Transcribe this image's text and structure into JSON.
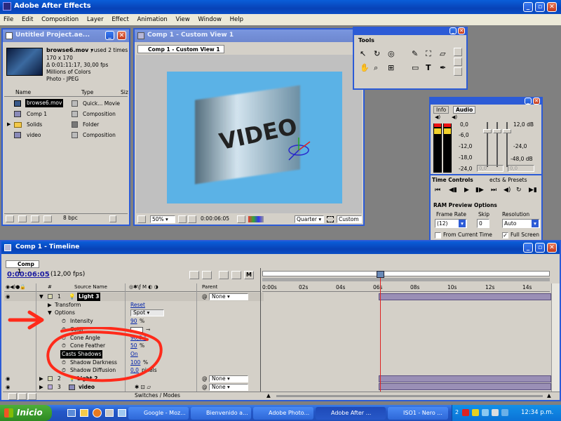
{
  "app": {
    "title": "Adobe After Effects",
    "menu": [
      "File",
      "Edit",
      "Composition",
      "Layer",
      "Effect",
      "Animation",
      "View",
      "Window",
      "Help"
    ]
  },
  "project": {
    "title": "Untitled Project.ae...",
    "file_name": "browse6.mov ▾",
    "used": ", used 2 times",
    "dims": "170 x 170",
    "duration": "Δ 0:01:11:17, 30,00 fps",
    "colors": "Millions of Colors",
    "codec": "Photo - JPEG",
    "col_name": "Name",
    "col_type": "Type",
    "col_size": "Siz",
    "items": [
      {
        "name": "browse6.mov",
        "type": "Quick... Movie"
      },
      {
        "name": "Comp 1",
        "type": "Composition"
      },
      {
        "name": "Solids",
        "type": "Folder"
      },
      {
        "name": "video",
        "type": "Composition"
      }
    ],
    "bpc": "8 bpc"
  },
  "comp": {
    "title": "Comp 1 - Custom View 1",
    "tab": "Comp 1 - Custom View 1",
    "zoom": "50%",
    "time": "0:00:06:05",
    "resolution": "Quarter",
    "view": "Custom View",
    "scene_text": "VIDEO"
  },
  "tools": {
    "title": "Tools"
  },
  "audio": {
    "tab_info": "Info",
    "tab_audio": "Audio",
    "left_scale": [
      "0,0",
      "-6,0",
      "-12,0",
      "-18,0",
      "-24,0"
    ],
    "right_scale": [
      "12,0 dB",
      "-24,0",
      "-48,0 dB"
    ],
    "field1": "0,0",
    "field2": "0,0"
  },
  "time_controls": {
    "tab1": "Time Controls",
    "tab2": "ects & Presets",
    "ram_title": "RAM Preview Options",
    "frame_rate_label": "Frame Rate",
    "skip_label": "Skip",
    "resolution_label": "Resolution",
    "frame_rate": "(12)",
    "skip": "0",
    "resolution": "Auto",
    "from_current": "From Current Time",
    "full_screen": "Full Screen"
  },
  "timeline": {
    "title": "Comp 1 - Timeline",
    "tab": "Comp 1",
    "time": "0:00:06:05",
    "fps": "(12,00 fps)",
    "col_source": "Source Name",
    "col_parent": "Parent",
    "ruler": [
      "0:00s",
      "02s",
      "04s",
      "06s",
      "08s",
      "10s",
      "12s",
      "14s"
    ],
    "footer": "Switches / Modes",
    "layers": [
      {
        "num": "1",
        "name": "Light 3",
        "parent": "None"
      },
      {
        "num": "2",
        "name": "Light 2",
        "parent": "None"
      },
      {
        "num": "3",
        "name": "video",
        "parent": "None"
      }
    ],
    "props": {
      "transform": "Transform",
      "reset": "Reset",
      "options": "Options",
      "options_val": "Spot",
      "intensity": "Intensity",
      "intensity_val": "90",
      "color": "Color",
      "cone_angle": "Cone Angle",
      "cone_angle_val": "90,0 °",
      "cone_feather": "Cone Feather",
      "cone_feather_val": "50",
      "casts_shadows": "Casts Shadows",
      "casts_shadows_val": "On",
      "shadow_darkness": "Shadow Darkness",
      "shadow_darkness_val": "100",
      "shadow_diffusion": "Shadow Diffusion",
      "shadow_diffusion_val": "0,0",
      "pixels": "pixels",
      "pct": "%"
    }
  },
  "taskbar": {
    "start": "Inicio",
    "clock": "12:34 p.m.",
    "tasks": [
      "Google - Moz...",
      "Bienvenido a...",
      "Adobe Photo...",
      "Adobe After ...",
      "ISO1 - Nero ...",
      "2"
    ]
  },
  "colors": {
    "accent": "#0a5ed9",
    "annotation": "#ff2a1a",
    "comp_bg": "#5bb2e6",
    "timeline_bar": "#9a8fb6"
  }
}
